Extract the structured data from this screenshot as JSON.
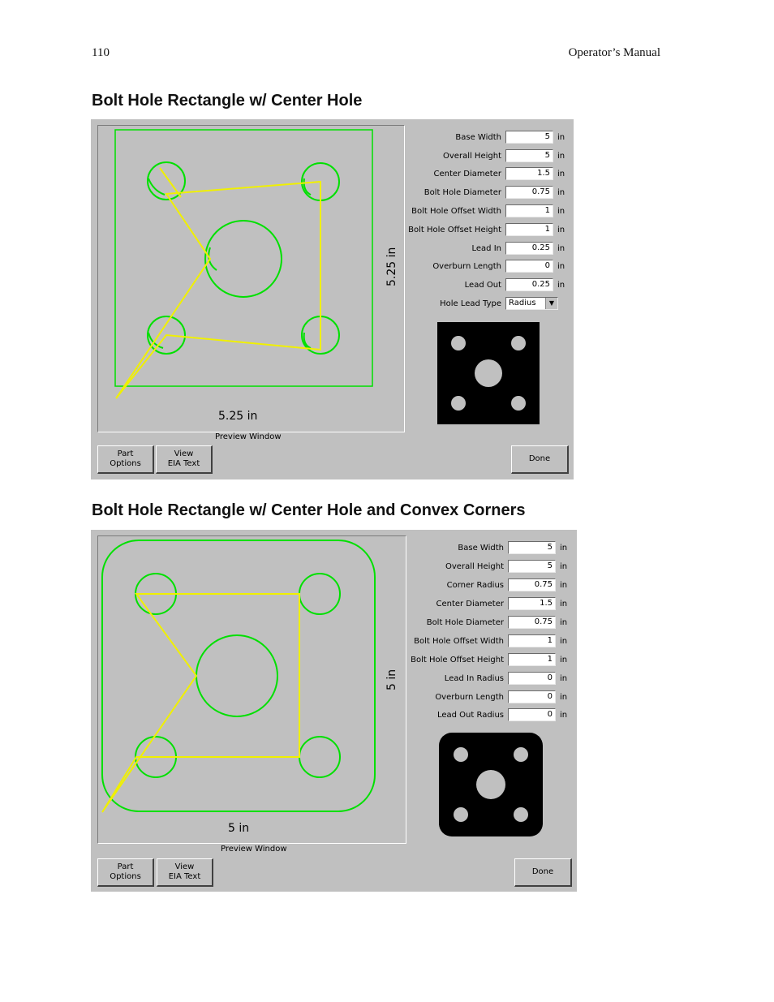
{
  "header": {
    "page_number": "110",
    "manual_title": "Operator’s Manual"
  },
  "section1": {
    "title": "Bolt Hole Rectangle w/ Center Hole",
    "dim_width": "5.25 in",
    "dim_height": "5.25 in",
    "preview_label": "Preview Window",
    "fields": [
      {
        "label": "Base Width",
        "value": "5",
        "unit": "in"
      },
      {
        "label": "Overall Height",
        "value": "5",
        "unit": "in"
      },
      {
        "label": "Center Diameter",
        "value": "1.5",
        "unit": "in"
      },
      {
        "label": "Bolt Hole Diameter",
        "value": "0.75",
        "unit": "in"
      },
      {
        "label": "Bolt Hole Offset Width",
        "value": "1",
        "unit": "in"
      },
      {
        "label": "Bolt Hole Offset Height",
        "value": "1",
        "unit": "in"
      },
      {
        "label": "Lead In",
        "value": "0.25",
        "unit": "in"
      },
      {
        "label": "Overburn Length",
        "value": "0",
        "unit": "in"
      },
      {
        "label": "Lead Out",
        "value": "0.25",
        "unit": "in"
      }
    ],
    "select": {
      "label": "Hole Lead Type",
      "value": "Radius",
      "arrow": "▼"
    },
    "buttons": {
      "part_options": "Part\nOptions",
      "view_eia": "View\nEIA Text",
      "done": "Done"
    }
  },
  "section2": {
    "title": "Bolt Hole Rectangle w/ Center Hole and Convex Corners",
    "dim_width": "5 in",
    "dim_height": "5 in",
    "preview_label": "Preview Window",
    "fields": [
      {
        "label": "Base Width",
        "value": "5",
        "unit": "in"
      },
      {
        "label": "Overall Height",
        "value": "5",
        "unit": "in"
      },
      {
        "label": "Corner Radius",
        "value": "0.75",
        "unit": "in"
      },
      {
        "label": "Center Diameter",
        "value": "1.5",
        "unit": "in"
      },
      {
        "label": "Bolt Hole Diameter",
        "value": "0.75",
        "unit": "in"
      },
      {
        "label": "Bolt Hole Offset Width",
        "value": "1",
        "unit": "in"
      },
      {
        "label": "Bolt Hole Offset Height",
        "value": "1",
        "unit": "in"
      },
      {
        "label": "Lead In Radius",
        "value": "0",
        "unit": "in"
      },
      {
        "label": "Overburn Length",
        "value": "0",
        "unit": "in"
      },
      {
        "label": "Lead Out Radius",
        "value": "0",
        "unit": "in"
      }
    ],
    "buttons": {
      "part_options": "Part\nOptions",
      "view_eia": "View\nEIA Text",
      "done": "Done"
    }
  },
  "colors": {
    "cut_path": "#00e000",
    "traverse": "#f0f000",
    "panel": "#c0c0c0"
  }
}
